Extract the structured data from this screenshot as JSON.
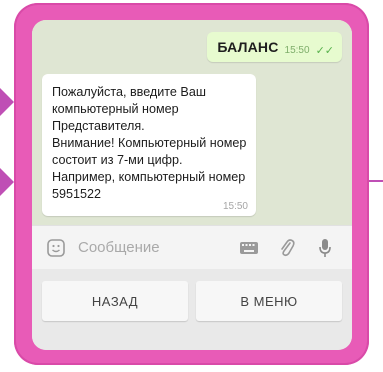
{
  "chat": {
    "outgoing": {
      "text": "БАЛАНС",
      "time": "15:50",
      "status": "✓✓"
    },
    "incoming": {
      "text": "Пожалуйста, введите Ваш\nкомпьютерный номер\nПредставителя.\nВнимание! Компьютерный номер\nсостоит из 7-ми цифр.\nНапример, компьютерный номер\n5951522",
      "time": "15:50"
    }
  },
  "input": {
    "placeholder": "Сообщение",
    "icons": [
      "smile-icon",
      "keyboard-icon",
      "paperclip-icon",
      "microphone-icon"
    ]
  },
  "keyboard": {
    "buttons": [
      "НАЗАД",
      "В МЕНЮ"
    ]
  },
  "colors": {
    "frame": "#e85bb7",
    "connector": "#bf4fb5",
    "outgoing_bubble": "#e7fbcf",
    "chat_background": "#dfe6d3"
  }
}
